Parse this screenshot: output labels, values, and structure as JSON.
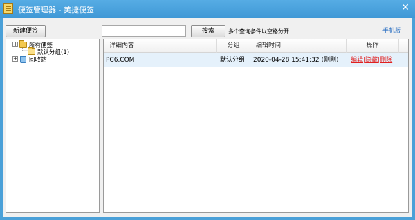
{
  "window": {
    "title": "便签管理器 - 美捷便签",
    "close_symbol": "✕",
    "accent_color": "#4aa0d8"
  },
  "toolbar": {
    "new_note_label": "新建便签",
    "search_value": "",
    "search_placeholder": "",
    "search_button_label": "搜索",
    "search_hint": "多个查询条件以空格分开",
    "mobile_link_label": "手机版"
  },
  "tree": {
    "expand_symbol": "+",
    "collapse_symbol": "−",
    "items": [
      {
        "label": "所有便签",
        "icon": "folder-icon",
        "expanded": true
      },
      {
        "label": "默认分组(1)",
        "icon": "folder-open-icon"
      },
      {
        "label": "回收站",
        "icon": "trash-icon",
        "expanded": false
      }
    ]
  },
  "table": {
    "columns": [
      "详细内容",
      "分组",
      "编辑时间",
      "操作"
    ],
    "rows": [
      {
        "content": "PC6.COM",
        "group": "默认分组",
        "edit_time": "2020-04-28 15:41:32 (刚刚)",
        "actions": [
          "编辑",
          "隐藏",
          "删除"
        ],
        "separator": "|"
      }
    ]
  }
}
